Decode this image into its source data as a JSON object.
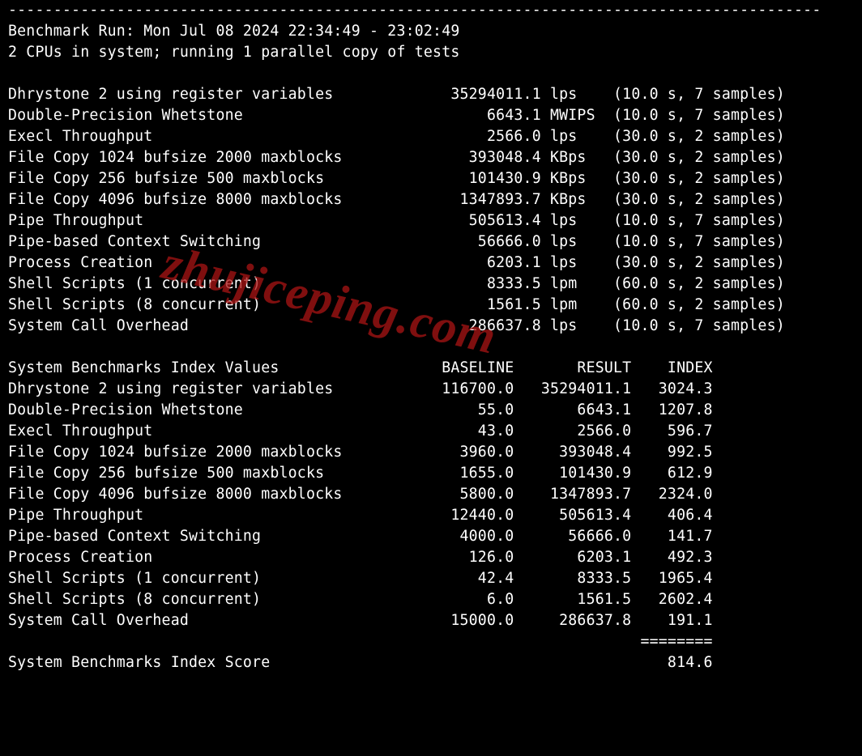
{
  "divider": "------------------------------------------------------------------------------------------",
  "run_line": "Benchmark Run: Mon Jul 08 2024 22:34:49 - 23:02:49",
  "cpu_line": "2 CPUs in system; running 1 parallel copy of tests",
  "watermark": "zhujiceping.com",
  "results": [
    {
      "name": "Dhrystone 2 using register variables",
      "value": "35294011.1",
      "unit": "lps",
      "timing": "(10.0 s, 7 samples)"
    },
    {
      "name": "Double-Precision Whetstone",
      "value": "6643.1",
      "unit": "MWIPS",
      "timing": "(10.0 s, 7 samples)"
    },
    {
      "name": "Execl Throughput",
      "value": "2566.0",
      "unit": "lps",
      "timing": "(30.0 s, 2 samples)"
    },
    {
      "name": "File Copy 1024 bufsize 2000 maxblocks",
      "value": "393048.4",
      "unit": "KBps",
      "timing": "(30.0 s, 2 samples)"
    },
    {
      "name": "File Copy 256 bufsize 500 maxblocks",
      "value": "101430.9",
      "unit": "KBps",
      "timing": "(30.0 s, 2 samples)"
    },
    {
      "name": "File Copy 4096 bufsize 8000 maxblocks",
      "value": "1347893.7",
      "unit": "KBps",
      "timing": "(30.0 s, 2 samples)"
    },
    {
      "name": "Pipe Throughput",
      "value": "505613.4",
      "unit": "lps",
      "timing": "(10.0 s, 7 samples)"
    },
    {
      "name": "Pipe-based Context Switching",
      "value": "56666.0",
      "unit": "lps",
      "timing": "(10.0 s, 7 samples)"
    },
    {
      "name": "Process Creation",
      "value": "6203.1",
      "unit": "lps",
      "timing": "(30.0 s, 2 samples)"
    },
    {
      "name": "Shell Scripts (1 concurrent)",
      "value": "8333.5",
      "unit": "lpm",
      "timing": "(60.0 s, 2 samples)"
    },
    {
      "name": "Shell Scripts (8 concurrent)",
      "value": "1561.5",
      "unit": "lpm",
      "timing": "(60.0 s, 2 samples)"
    },
    {
      "name": "System Call Overhead",
      "value": "286637.8",
      "unit": "lps",
      "timing": "(10.0 s, 7 samples)"
    }
  ],
  "index_header": {
    "title": "System Benchmarks Index Values",
    "c1": "BASELINE",
    "c2": "RESULT",
    "c3": "INDEX"
  },
  "index_rows": [
    {
      "name": "Dhrystone 2 using register variables",
      "baseline": "116700.0",
      "result": "35294011.1",
      "index": "3024.3"
    },
    {
      "name": "Double-Precision Whetstone",
      "baseline": "55.0",
      "result": "6643.1",
      "index": "1207.8"
    },
    {
      "name": "Execl Throughput",
      "baseline": "43.0",
      "result": "2566.0",
      "index": "596.7"
    },
    {
      "name": "File Copy 1024 bufsize 2000 maxblocks",
      "baseline": "3960.0",
      "result": "393048.4",
      "index": "992.5"
    },
    {
      "name": "File Copy 256 bufsize 500 maxblocks",
      "baseline": "1655.0",
      "result": "101430.9",
      "index": "612.9"
    },
    {
      "name": "File Copy 4096 bufsize 8000 maxblocks",
      "baseline": "5800.0",
      "result": "1347893.7",
      "index": "2324.0"
    },
    {
      "name": "Pipe Throughput",
      "baseline": "12440.0",
      "result": "505613.4",
      "index": "406.4"
    },
    {
      "name": "Pipe-based Context Switching",
      "baseline": "4000.0",
      "result": "56666.0",
      "index": "141.7"
    },
    {
      "name": "Process Creation",
      "baseline": "126.0",
      "result": "6203.1",
      "index": "492.3"
    },
    {
      "name": "Shell Scripts (1 concurrent)",
      "baseline": "42.4",
      "result": "8333.5",
      "index": "1965.4"
    },
    {
      "name": "Shell Scripts (8 concurrent)",
      "baseline": "6.0",
      "result": "1561.5",
      "index": "2602.4"
    },
    {
      "name": "System Call Overhead",
      "baseline": "15000.0",
      "result": "286637.8",
      "index": "191.1"
    }
  ],
  "index_separator": "========",
  "score_label": "System Benchmarks Index Score",
  "score_value": "814.6",
  "cols": {
    "results_name_w": 41,
    "results_value_w": 18,
    "results_unit_w": 6,
    "idx_name_w": 43,
    "idx_baseline_w": 13,
    "idx_result_w": 13,
    "idx_index_w": 9,
    "score_name_w": 69
  }
}
